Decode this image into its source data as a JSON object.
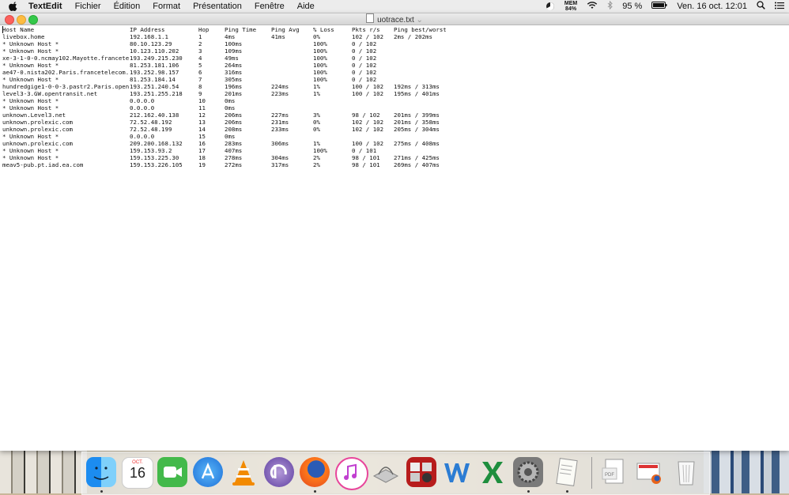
{
  "menubar": {
    "app_name": "TextEdit",
    "items": [
      "Fichier",
      "Édition",
      "Format",
      "Présentation",
      "Fenêtre",
      "Aide"
    ],
    "mem_label": "MEM",
    "mem_value": "84%",
    "battery": "95 %",
    "datetime": "Ven. 16 oct.  12:01"
  },
  "window": {
    "title": "uotrace.txt"
  },
  "table": {
    "headers": [
      "Host Name",
      "IP Address",
      "Hop",
      "Ping Time",
      "Ping Avg",
      "% Loss",
      "Pkts r/s",
      "Ping best/worst"
    ],
    "rows": [
      [
        "livebox.home",
        "192.168.1.1",
        "1",
        "4ms",
        "41ms",
        "0%",
        "102 / 102",
        "2ms / 202ms"
      ],
      [
        "* Unknown Host *",
        "80.10.123.29",
        "2",
        "100ms",
        "",
        "100%",
        "0 / 102",
        ""
      ],
      [
        "* Unknown Host *",
        "10.123.110.202",
        "3",
        "109ms",
        "",
        "100%",
        "0 / 102",
        ""
      ],
      [
        "xe-3-1-0-0.ncmay102.Mayotte.francetelecom.net",
        "193.249.215.230",
        "4",
        "49ms",
        "",
        "100%",
        "0 / 102",
        ""
      ],
      [
        "* Unknown Host *",
        "81.253.181.106",
        "5",
        "264ms",
        "",
        "100%",
        "0 / 102",
        ""
      ],
      [
        "ae47-0.nista202.Paris.francetelecom.net",
        "193.252.98.157",
        "6",
        "316ms",
        "",
        "100%",
        "0 / 102",
        ""
      ],
      [
        "* Unknown Host *",
        "81.253.184.14",
        "7",
        "305ms",
        "",
        "100%",
        "0 / 102",
        ""
      ],
      [
        "hundredgige1-0-0-3.pastr2.Paris.opentransit.net",
        "193.251.240.54",
        "8",
        "196ms",
        "224ms",
        "1%",
        "100 / 102",
        "192ms / 313ms"
      ],
      [
        "level3-3.GW.opentransit.net",
        "193.251.255.218",
        "9",
        "201ms",
        "223ms",
        "1%",
        "100 / 102",
        "195ms / 401ms"
      ],
      [
        "* Unknown Host *",
        "0.0.0.0",
        "10",
        "0ms",
        "",
        "",
        "",
        ""
      ],
      [
        "* Unknown Host *",
        "0.0.0.0",
        "11",
        "0ms",
        "",
        "",
        "",
        ""
      ],
      [
        "unknown.Level3.net",
        "212.162.40.138",
        "12",
        "206ms",
        "227ms",
        "3%",
        "98 / 102",
        "201ms / 399ms"
      ],
      [
        "unknown.prolexic.com",
        "72.52.48.192",
        "13",
        "206ms",
        "231ms",
        "0%",
        "102 / 102",
        "201ms / 358ms"
      ],
      [
        "unknown.prolexic.com",
        "72.52.48.199",
        "14",
        "208ms",
        "233ms",
        "0%",
        "102 / 102",
        "205ms / 304ms"
      ],
      [
        "* Unknown Host *",
        "0.0.0.0",
        "15",
        "0ms",
        "",
        "",
        "",
        ""
      ],
      [
        "unknown.prolexic.com",
        "209.200.168.132",
        "16",
        "283ms",
        "306ms",
        "1%",
        "100 / 102",
        "275ms / 408ms"
      ],
      [
        "* Unknown Host *",
        "159.153.93.2",
        "17",
        "407ms",
        "",
        "100%",
        "0 / 101",
        ""
      ],
      [
        "* Unknown Host *",
        "159.153.225.30",
        "18",
        "278ms",
        "304ms",
        "2%",
        "98 / 101",
        "271ms / 425ms"
      ],
      [
        "meav5-pub.pt.iad.ea.com",
        "159.153.226.105",
        "19",
        "272ms",
        "317ms",
        "2%",
        "98 / 101",
        "269ms / 407ms"
      ]
    ]
  },
  "dock": {
    "calendar_month": "OCT.",
    "calendar_day": "16",
    "icons": [
      "finder-icon",
      "calendar-icon",
      "facetime-icon",
      "app-store-icon",
      "vlc-icon",
      "bittorrent-icon",
      "firefox-icon",
      "itunes-icon",
      "grapher-icon",
      "photo-booth-icon",
      "word-icon",
      "excel-icon",
      "system-preferences-icon",
      "textedit-icon",
      "preview-pdf-icon",
      "firefox-document-icon",
      "trash-icon"
    ]
  }
}
